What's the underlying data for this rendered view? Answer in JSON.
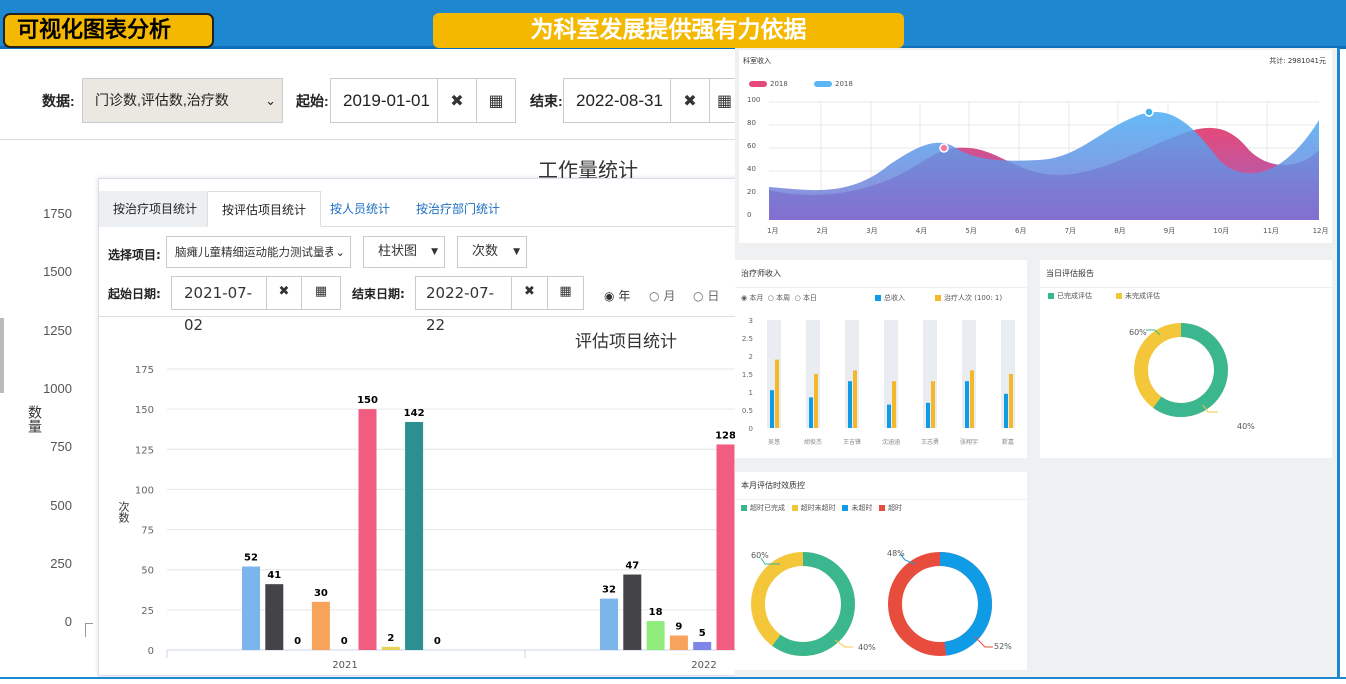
{
  "header": {
    "brand": "可视化图表分析",
    "slogan": "为科室发展提供强有力依据"
  },
  "filter": {
    "data_label": "数据:",
    "data_value": "门诊数,评估数,治疗数",
    "start_label": "起始:",
    "start_value": "2019-01-01",
    "end_label": "结束:",
    "end_value": "2022-08-31"
  },
  "bg_chart": {
    "title": "工作量统计",
    "ylabel": "数量",
    "yticks": [
      "1750",
      "1500",
      "1250",
      "1000",
      "750",
      "500",
      "250",
      "0"
    ]
  },
  "panel": {
    "tabs": [
      "按治疗项目统计",
      "按评估项目统计",
      "按人员统计",
      "按治疗部门统计"
    ],
    "project_label": "选择项目:",
    "project_value": "脑瘫儿童精细运动能力测试量表",
    "chart_type": "柱状图",
    "metric": "次数",
    "start_label": "起始日期:",
    "start_value": "2021-07-02",
    "end_label": "结束日期:",
    "end_value": "2022-07-22",
    "radio": [
      "年",
      "月",
      "日"
    ],
    "chart_title": "评估项目统计",
    "ylabel": "次数"
  },
  "chart_data": {
    "type": "bar",
    "title": "评估项目统计",
    "ylabel": "次数",
    "ylim": [
      0,
      175
    ],
    "yticks": [
      0,
      25,
      50,
      75,
      100,
      125,
      150,
      175
    ],
    "categories": [
      "2021",
      "2022"
    ],
    "colors": [
      "#7cb5ec",
      "#434348",
      "#90ed7d",
      "#f7a35c",
      "#8085e9",
      "#f15c80",
      "#e4d354",
      "#2b908f"
    ],
    "series_values": [
      [
        52,
        41,
        0,
        30,
        0,
        150,
        2,
        142,
        0
      ],
      [
        32,
        47,
        18,
        9,
        5,
        128
      ]
    ]
  },
  "dash": {
    "income": {
      "title": "科室收入",
      "total": "共计: 2981041元",
      "legend": [
        "2018",
        "2018"
      ],
      "yticks": [
        "100",
        "80",
        "60",
        "40",
        "20",
        "0"
      ],
      "months": [
        "1月",
        "2月",
        "3月",
        "4月",
        "5月",
        "6月",
        "7月",
        "8月",
        "9月",
        "10月",
        "11月",
        "12月"
      ]
    },
    "therapist": {
      "title": "治疗师收入",
      "radios": [
        "本月",
        "本周",
        "本日"
      ],
      "legend": [
        "总收入",
        "治疗人次 (100: 1)"
      ],
      "yticks": [
        "3",
        "2.5",
        "2",
        "1.5",
        "1",
        "0.5",
        "0"
      ],
      "names": [
        "吴悠",
        "胡俊杰",
        "王吉锋",
        "沈涵涵",
        "王志勇",
        "张翔宇",
        "靳嘉"
      ]
    },
    "today": {
      "title": "当日评估报告",
      "legend": [
        "已完成评估",
        "未完成评估"
      ],
      "p1": "60%",
      "p2": "40%"
    },
    "quality": {
      "title": "本月评估时效质控",
      "legend": [
        "超时已完成",
        "超时未超时",
        "未超时",
        "超时"
      ],
      "d1a": "60%",
      "d1b": "40%",
      "d2a": "48%",
      "d2b": "52%"
    }
  }
}
